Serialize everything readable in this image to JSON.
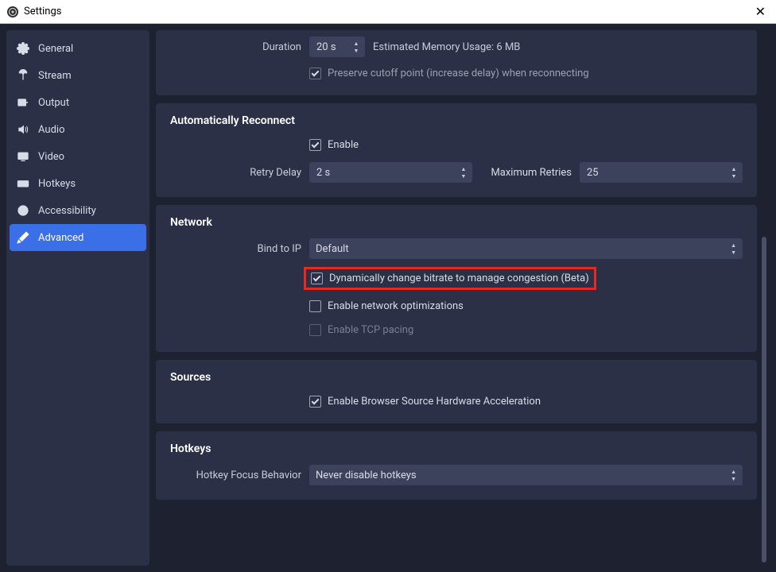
{
  "window": {
    "title": "Settings"
  },
  "sidebar": {
    "items": [
      {
        "label": "General"
      },
      {
        "label": "Stream"
      },
      {
        "label": "Output"
      },
      {
        "label": "Audio"
      },
      {
        "label": "Video"
      },
      {
        "label": "Hotkeys"
      },
      {
        "label": "Accessibility"
      },
      {
        "label": "Advanced"
      }
    ]
  },
  "delay": {
    "duration_label": "Duration",
    "duration_value": "20 s",
    "memory_hint": "Estimated Memory Usage: 6 MB",
    "preserve_label": "Preserve cutoff point (increase delay) when reconnecting"
  },
  "reconnect": {
    "title": "Automatically Reconnect",
    "enable_label": "Enable",
    "retry_delay_label": "Retry Delay",
    "retry_delay_value": "2 s",
    "max_retries_label": "Maximum Retries",
    "max_retries_value": "25"
  },
  "network": {
    "title": "Network",
    "bind_label": "Bind to IP",
    "bind_value": "Default",
    "dynamic_label": "Dynamically change bitrate to manage congestion (Beta)",
    "opt_label": "Enable network optimizations",
    "tcp_label": "Enable TCP pacing"
  },
  "sources": {
    "title": "Sources",
    "browser_accel_label": "Enable Browser Source Hardware Acceleration"
  },
  "hotkeys": {
    "title": "Hotkeys",
    "focus_label": "Hotkey Focus Behavior",
    "focus_value": "Never disable hotkeys"
  }
}
